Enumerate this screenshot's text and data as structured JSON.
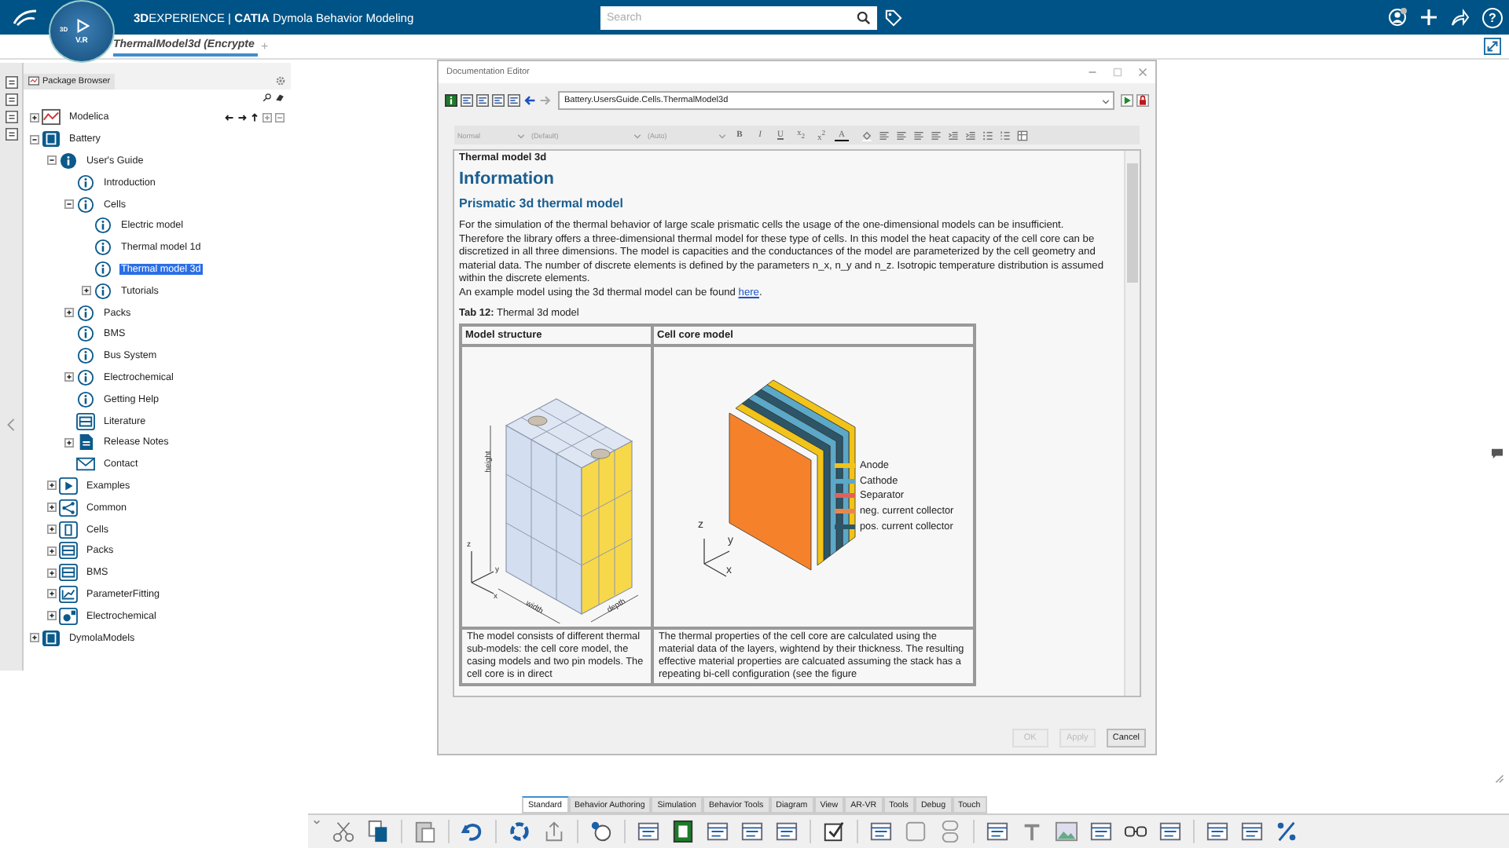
{
  "topbar": {
    "compass_top": "3D",
    "compass_bottom": "V.R",
    "brand": "**3D**EXPERIENCE | **CATIA** Dymola Behavior Modeling",
    "search": {
      "placeholder": "Search"
    },
    "help": "?"
  },
  "tab_bar": {
    "tabs": [
      {
        "label": "ThermalModel3d (Encrypte",
        "selected": true
      }
    ],
    "add": "+"
  },
  "package_browser": {
    "title": "Package Browser",
    "tree": [
      {
        "label": "Modelica",
        "kind": "modelica",
        "expanded": false,
        "selected": false
      },
      {
        "label": "Battery",
        "kind": "library",
        "expanded": true,
        "selected": false,
        "children": [
          {
            "label": "User's Guide",
            "kind": "info-filled",
            "expanded": true,
            "selected": false,
            "children": [
              {
                "label": "Introduction",
                "kind": "info",
                "selected": false
              },
              {
                "label": "Cells",
                "kind": "info",
                "expanded": true,
                "selected": false,
                "children": [
                  {
                    "label": "Electric model",
                    "kind": "info",
                    "selected": false
                  },
                  {
                    "label": "Thermal model 1d",
                    "kind": "info",
                    "selected": false
                  },
                  {
                    "label": "Thermal model 3d",
                    "kind": "info",
                    "selected": true
                  },
                  {
                    "label": "Tutorials",
                    "kind": "info",
                    "expanded": false,
                    "selected": false
                  }
                ]
              },
              {
                "label": "Packs",
                "kind": "info",
                "expanded": false,
                "selected": false
              },
              {
                "label": "BMS",
                "kind": "info",
                "selected": false
              },
              {
                "label": "Bus System",
                "kind": "info",
                "selected": false
              },
              {
                "label": "Electrochemical",
                "kind": "info",
                "expanded": false,
                "selected": false
              },
              {
                "label": "Getting Help",
                "kind": "info",
                "selected": false
              },
              {
                "label": "Literature",
                "kind": "literature",
                "selected": false
              },
              {
                "label": "Release Notes",
                "kind": "notes",
                "expanded": false,
                "selected": false
              },
              {
                "label": "Contact",
                "kind": "mail",
                "selected": false
              }
            ]
          },
          {
            "label": "Examples",
            "kind": "play",
            "expanded": false,
            "selected": false
          },
          {
            "label": "Common",
            "kind": "share",
            "expanded": false,
            "selected": false
          },
          {
            "label": "Cells",
            "kind": "cell",
            "expanded": false,
            "selected": false
          },
          {
            "label": "Packs",
            "kind": "pack",
            "expanded": false,
            "selected": false
          },
          {
            "label": "BMS",
            "kind": "bms",
            "expanded": false,
            "selected": false
          },
          {
            "label": "ParameterFitting",
            "kind": "plot",
            "expanded": false,
            "selected": false
          },
          {
            "label": "Electrochemical",
            "kind": "network",
            "expanded": false,
            "selected": false
          }
        ]
      },
      {
        "label": "DymolaModels",
        "kind": "dymola",
        "expanded": false,
        "selected": false
      }
    ]
  },
  "doc_editor": {
    "title": "Documentation Editor",
    "address": "Battery.UsersGuide.Cells.ThermalModel3d",
    "format": {
      "style": "Normal",
      "font": "(Default)",
      "size": "(Auto)",
      "buttons": [
        "B",
        "I",
        "U",
        "x$_{2}$",
        "x$^{2}$",
        "A"
      ]
    },
    "content": {
      "name": "Thermal model 3d",
      "heading": "Information",
      "subheading": "Prismatic 3d thermal model",
      "paragraph": "For the simulation of the thermal behavior of large scale prismatic cells the usage of the one-dimensional models can be insufficient. Therefore the library offers a three-dimensional thermal model for these type of cells. In this model the heat capacity of the cell core can be discretized in all three dimensions. The model is capacities and the conductances of the model are parameterized by the cell geometry and material data. The number of discrete elements is defined by the parameters n_x, n_y and n_z. Isotropic temperature distribution is assumed within the discrete elements.",
      "example": {
        "text": "An example model using the 3d thermal model can be found ",
        "link": "here",
        "end": "."
      },
      "caption": "**Tab 12:** Thermal 3d model",
      "columns": [
        "Model structure",
        "Cell core model"
      ],
      "casing_labels": {
        "height": "height",
        "width": "width",
        "depth": "depth",
        "x": "x",
        "y": "y",
        "z": "z"
      },
      "core_axes": {
        "x": "x",
        "y": "y",
        "z": "z"
      },
      "legend": [
        {
          "label": "Anode",
          "color": "#f2c318"
        },
        {
          "label": "Cathode",
          "color": "#5ba8c8"
        },
        {
          "label": "Separator",
          "color": "#e0615a"
        },
        {
          "label": "neg. current collector",
          "color": "#e8874c"
        },
        {
          "label": "pos. current collector",
          "color": "#2c5668"
        }
      ],
      "descriptions": [
        "The model consists of different thermal sub-models: the cell core model, the casing models and two pin models. The cell core is in direct",
        "The thermal properties of the cell core are calculated using the material data of the layers, wightend by their thickness. The resulting effective material properties are calcuated assuming the stack has a repeating bi-cell configuration (see the figure"
      ]
    },
    "buttons": [
      {
        "label": "OK",
        "disabled": true
      },
      {
        "label": "Apply",
        "disabled": true
      },
      {
        "label": "Cancel",
        "disabled": false
      }
    ]
  },
  "bottom_toolbar": {
    "tabs": [
      {
        "label": "Standard",
        "selected": true
      },
      {
        "label": "Behavior Authoring",
        "selected": false
      },
      {
        "label": "Simulation",
        "selected": false
      },
      {
        "label": "Behavior Tools",
        "selected": false
      },
      {
        "label": "Diagram",
        "selected": false
      },
      {
        "label": "View",
        "selected": false
      },
      {
        "label": "AR-VR",
        "selected": false
      },
      {
        "label": "Tools",
        "selected": false
      },
      {
        "label": "Debug",
        "selected": false
      },
      {
        "label": "Touch",
        "selected": false
      }
    ]
  }
}
